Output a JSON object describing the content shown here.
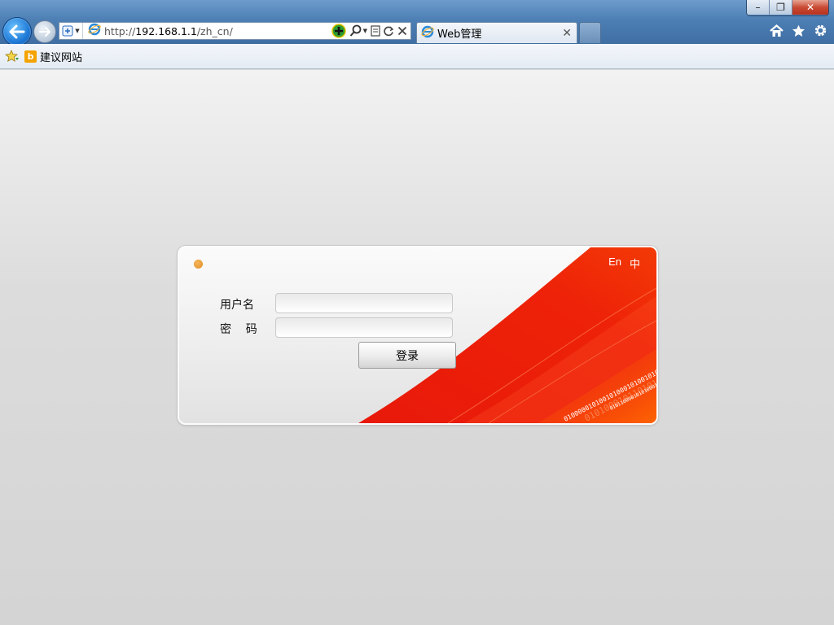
{
  "browser": {
    "url_prefix": "http://",
    "url_host": "192.168.1.1",
    "url_path": "/zh_cn/",
    "tab_title": "Web管理",
    "window_controls": {
      "minimize": "–",
      "restore": "❐",
      "close": "✕"
    }
  },
  "favorites": {
    "items": [
      {
        "label": "建议网站"
      }
    ]
  },
  "login": {
    "lang_en": "En",
    "lang_zh": "中",
    "username_label": "用户名",
    "password_label": "密    码",
    "username_value": "",
    "password_value": "",
    "submit_label": "登录",
    "binary_text": "0100000101001010001010010100101010010100101",
    "binary_text2": "0101000101101010000100101001010010",
    "binary_text3": "0101100001010100010100101010010101"
  },
  "colors": {
    "accent_red": "#e8190a",
    "dot_orange": "#e08b23"
  }
}
